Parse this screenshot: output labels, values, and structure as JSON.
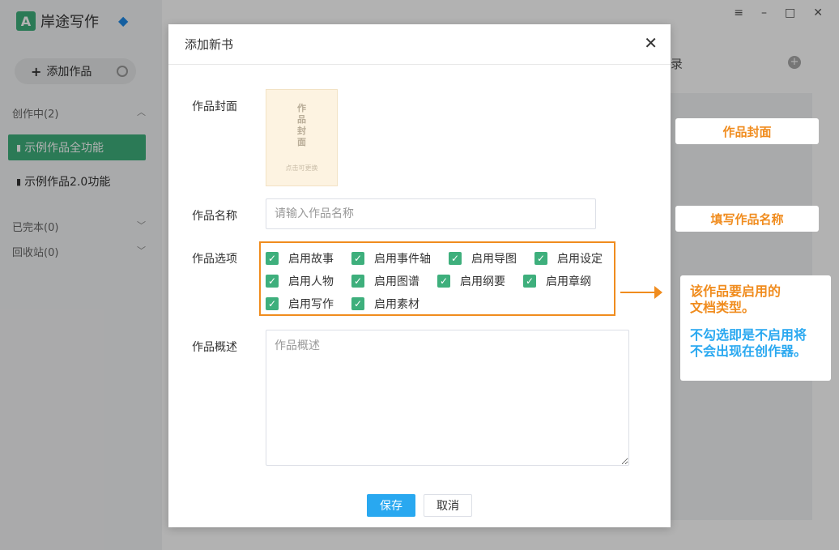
{
  "app": {
    "logo_mark": "A",
    "logo_text": "岸途写作",
    "add_work_label": "添加作品",
    "groups": {
      "writing": "创作中(2)",
      "finished": "已完本(0)",
      "recycle": "回收站(0)"
    },
    "works": [
      {
        "label": "示例作品全功能",
        "active": true
      },
      {
        "label": "示例作品2.0功能",
        "active": false
      }
    ],
    "right_title": "录",
    "window_controls": [
      "menu-icon",
      "minimize-icon",
      "maximize-icon",
      "close-icon"
    ]
  },
  "modal": {
    "title": "添加新书",
    "cover_label": "作品封面",
    "cover_title": "作品封面",
    "cover_hint": "点击可更换",
    "name_label": "作品名称",
    "name_placeholder": "请输入作品名称",
    "options_label": "作品选项",
    "options": [
      {
        "label": "启用故事",
        "checked": true
      },
      {
        "label": "启用事件轴",
        "checked": true
      },
      {
        "label": "启用导图",
        "checked": true
      },
      {
        "label": "启用设定",
        "checked": true
      },
      {
        "label": "启用人物",
        "checked": true
      },
      {
        "label": "启用图谱",
        "checked": true
      },
      {
        "label": "启用纲要",
        "checked": true
      },
      {
        "label": "启用章纲",
        "checked": true
      },
      {
        "label": "启用写作",
        "checked": true
      },
      {
        "label": "启用素材",
        "checked": true
      }
    ],
    "desc_label": "作品概述",
    "desc_placeholder": "作品概述",
    "save_label": "保存",
    "cancel_label": "取消"
  },
  "annotations": {
    "cover": "作品封面",
    "name": "填写作品名称",
    "options_line1": "该作品要启用的",
    "options_line2": "文档类型。",
    "options_line3": "不勾选即是不启用将",
    "options_line4": "不会出现在创作器。"
  },
  "colors": {
    "brand_green": "#3eaf7c",
    "annotation_orange": "#f08c1e",
    "primary_blue": "#29a8f0"
  }
}
